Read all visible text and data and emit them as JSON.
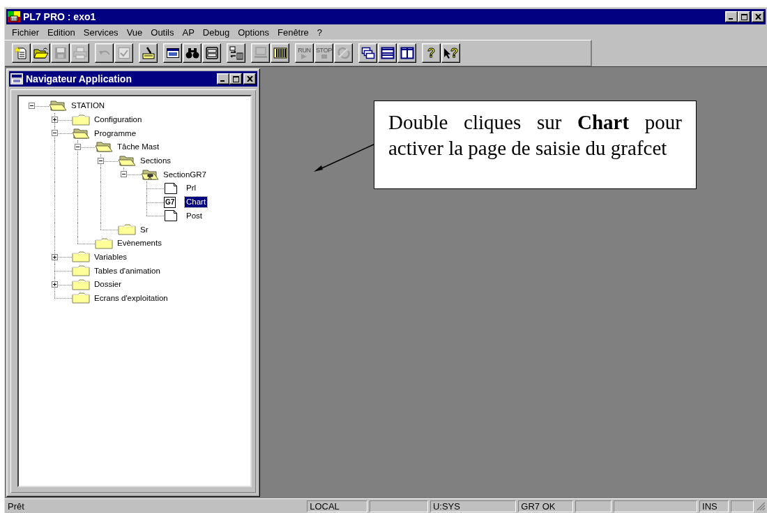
{
  "window": {
    "title": "PL7 PRO : exo1"
  },
  "menu": [
    "Fichier",
    "Edition",
    "Services",
    "Vue",
    "Outils",
    "AP",
    "Debug",
    "Options",
    "Fenêtre",
    "?"
  ],
  "toolbar": [
    [
      {
        "kind": "new",
        "disabled": false
      },
      {
        "kind": "open",
        "disabled": false
      },
      {
        "kind": "save",
        "disabled": true
      },
      {
        "kind": "print",
        "disabled": true
      }
    ],
    [
      {
        "kind": "undo",
        "disabled": true
      },
      {
        "kind": "check",
        "disabled": true
      }
    ],
    [
      {
        "kind": "transfer",
        "disabled": false
      }
    ],
    [
      {
        "kind": "window",
        "disabled": false
      },
      {
        "kind": "find",
        "disabled": false
      },
      {
        "kind": "drawer",
        "disabled": false
      }
    ],
    [
      {
        "kind": "io",
        "disabled": false
      }
    ],
    [
      {
        "kind": "monitor",
        "disabled": true
      },
      {
        "kind": "rack",
        "disabled": false
      }
    ],
    [
      {
        "kind": "run",
        "disabled": true,
        "label": "RUN"
      },
      {
        "kind": "stop",
        "disabled": true,
        "label": "STOP"
      },
      {
        "kind": "connect",
        "disabled": true
      }
    ],
    [
      {
        "kind": "cascade",
        "disabled": false
      },
      {
        "kind": "tileh",
        "disabled": false
      },
      {
        "kind": "tilev",
        "disabled": false
      }
    ],
    [
      {
        "kind": "help",
        "disabled": false,
        "label": "?"
      },
      {
        "kind": "helpcursor",
        "disabled": false,
        "label": "?"
      }
    ]
  ],
  "navigator": {
    "title": "Navigateur Application",
    "tree": [
      {
        "label": "STATION",
        "kind": "folder-open",
        "selected": false,
        "expanded": true,
        "children": [
          {
            "label": "Configuration",
            "kind": "folder",
            "selected": false,
            "expanded": false
          },
          {
            "label": "Programme",
            "kind": "folder-open",
            "selected": false,
            "expanded": true,
            "children": [
              {
                "label": "Tâche Mast",
                "kind": "folder-open",
                "selected": false,
                "expanded": true,
                "children": [
                  {
                    "label": "Sections",
                    "kind": "folder-open",
                    "selected": false,
                    "expanded": true,
                    "children": [
                      {
                        "label": "SectionGR7",
                        "kind": "section",
                        "selected": false,
                        "expanded": true,
                        "children": [
                          {
                            "label": "Prl",
                            "kind": "doc",
                            "selected": false
                          },
                          {
                            "label": "Chart",
                            "kind": "grafcet",
                            "badge": "G7",
                            "selected": true
                          },
                          {
                            "label": "Post",
                            "kind": "doc",
                            "selected": false
                          }
                        ]
                      }
                    ]
                  },
                  {
                    "label": "Sr",
                    "kind": "folder",
                    "selected": false
                  }
                ]
              },
              {
                "label": "Evènements",
                "kind": "folder",
                "selected": false
              }
            ]
          },
          {
            "label": "Variables",
            "kind": "folder",
            "selected": false,
            "expanded": false
          },
          {
            "label": "Tables d'animation",
            "kind": "folder",
            "selected": false
          },
          {
            "label": "Dossier",
            "kind": "folder",
            "selected": false,
            "expanded": false
          },
          {
            "label": "Ecrans d'exploitation",
            "kind": "folder",
            "selected": false
          }
        ]
      }
    ]
  },
  "callout": {
    "text": "Double cliques sur **Chart** pour activer la page de saisie du grafcet"
  },
  "status_bar": {
    "message": "Prêt",
    "panes": [
      {
        "kind": "text",
        "text": "LOCAL"
      },
      {
        "kind": "blank"
      },
      {
        "kind": "text",
        "text": "U:SYS"
      },
      {
        "kind": "text",
        "text": "GR7 OK"
      },
      {
        "kind": "blank"
      },
      {
        "kind": "blank"
      },
      {
        "kind": "text",
        "text": "INS"
      },
      {
        "kind": "blank"
      }
    ]
  }
}
